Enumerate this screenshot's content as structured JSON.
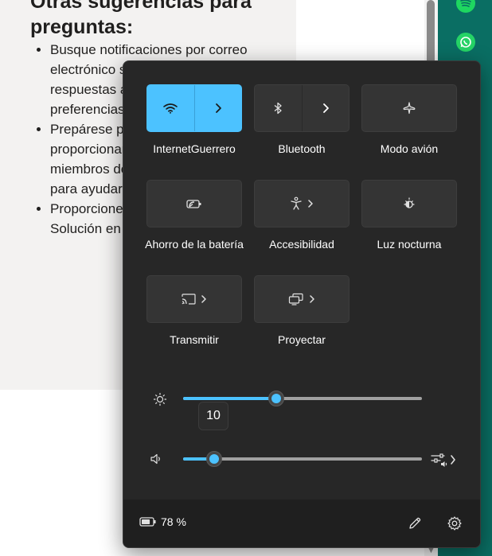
{
  "document": {
    "heading": "Otras sugerencias para preguntas:",
    "bullets": [
      "Busque notificaciones por correo electrónico sobre sus publicaciones y respuestas a sus publicaciones en sus preferencias de correo electrónico.",
      "Prepárese para recibir soluciones que le proporcionarán respuestas que otros miembros de la comunidad han compartido para ayudarle.",
      "Proporcione comentarios marcando Solución en la respuesta."
    ]
  },
  "quick_settings": {
    "tiles": [
      {
        "label": "InternetGuerrero",
        "icon": "wifi-icon",
        "active": true,
        "has_arrow": true
      },
      {
        "label": "Bluetooth",
        "icon": "bluetooth-icon",
        "active": false,
        "has_arrow": true
      },
      {
        "label": "Modo avión",
        "icon": "airplane-icon",
        "active": false,
        "has_arrow": false
      },
      {
        "label": "Ahorro de la batería",
        "icon": "battery-saver-icon",
        "active": false,
        "has_arrow": false
      },
      {
        "label": "Accesibilidad",
        "icon": "accessibility-icon",
        "active": false,
        "has_arrow": true
      },
      {
        "label": "Luz nocturna",
        "icon": "night-light-icon",
        "active": false,
        "has_arrow": false
      },
      {
        "label": "Transmitir",
        "icon": "cast-icon",
        "active": false,
        "has_arrow": true
      },
      {
        "label": "Proyectar",
        "icon": "project-icon",
        "active": false,
        "has_arrow": true
      }
    ],
    "brightness": {
      "value": 39,
      "tooltip": "10",
      "icon": "brightness-icon"
    },
    "volume": {
      "value": 13,
      "icon": "speaker-icon"
    },
    "footer": {
      "battery_text": "78 %",
      "battery_level": 78
    }
  },
  "colors": {
    "accent": "#4cc2ff",
    "panel": "#272727",
    "tile": "#343434"
  }
}
